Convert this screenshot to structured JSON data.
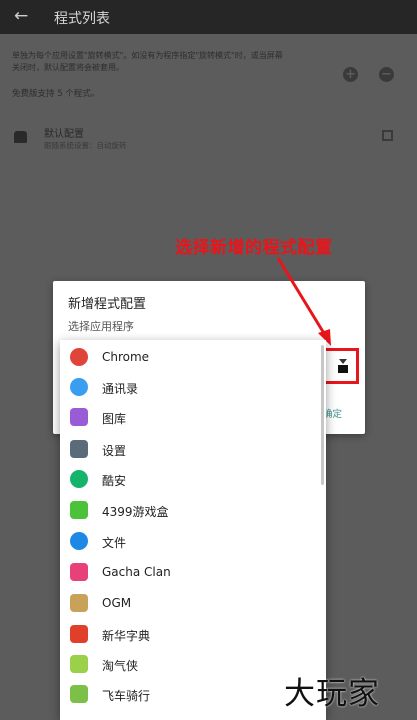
{
  "appbar": {
    "back": "←",
    "title": "程式列表"
  },
  "description": {
    "line1": "单独为每个应用设置\"旋转模式\"。如没有为程序指定\"旋转模式\"时，或当屏幕",
    "line2": "关闭时，默认配置将会被套用。"
  },
  "free_note": "免费版支持 5 个程式。",
  "buttons": {
    "add": "+",
    "remove": "−"
  },
  "default_config": {
    "title": "默认配置",
    "subtitle": "跟随系统设置：自动旋转"
  },
  "annotation": "选择新增的程式配置",
  "dialog": {
    "title": "新增程式配置",
    "subtitle": "选择应用程序",
    "confirm": "确定"
  },
  "apps": [
    {
      "label": "Chrome",
      "icon": "chrome-icon",
      "color": "#e0453a"
    },
    {
      "label": "通讯录",
      "icon": "contacts-icon",
      "color": "#3a9ef0"
    },
    {
      "label": "图库",
      "icon": "gallery-icon",
      "color": "#9a5bd6"
    },
    {
      "label": "设置",
      "icon": "settings-gear-icon",
      "color": "#5b6b7a"
    },
    {
      "label": "酷安",
      "icon": "coolapk-icon",
      "color": "#16b36a"
    },
    {
      "label": "4399游戏盒",
      "icon": "4399-icon",
      "color": "#4cc13a"
    },
    {
      "label": "文件",
      "icon": "files-icon",
      "color": "#1e88e5"
    },
    {
      "label": "Gacha Clan",
      "icon": "gacha-icon",
      "color": "#e8417a"
    },
    {
      "label": "OGM",
      "icon": "ogm-icon",
      "color": "#c9a25a"
    },
    {
      "label": "新华字典",
      "icon": "dictionary-icon",
      "color": "#e0402a"
    },
    {
      "label": "淘气侠",
      "icon": "taoqixia-icon",
      "color": "#9ad04a"
    },
    {
      "label": "飞车骑行",
      "icon": "android-icon",
      "color": "#7cc04a"
    }
  ],
  "watermark": "大玩家"
}
